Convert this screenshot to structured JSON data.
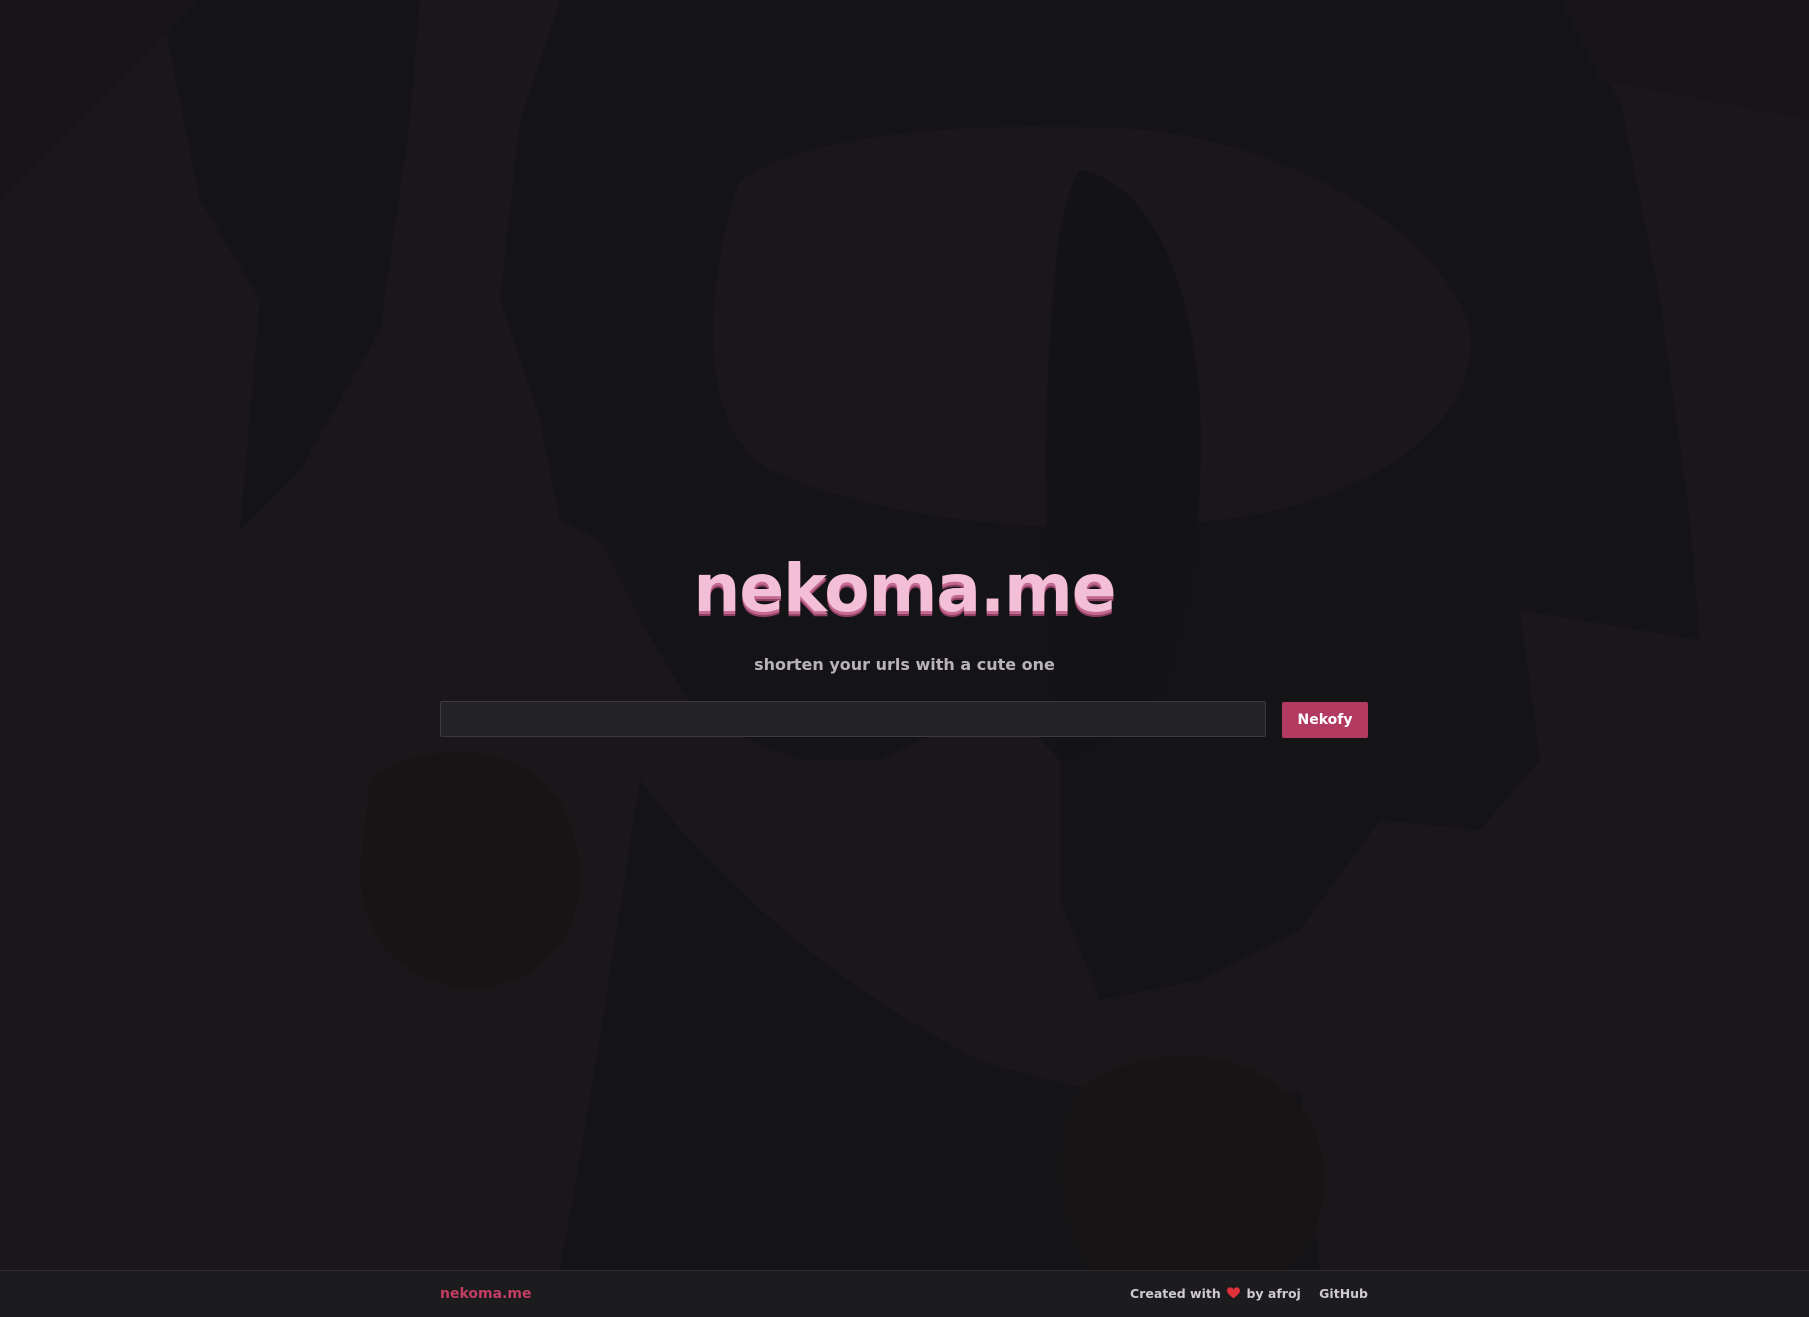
{
  "site": {
    "logo_text": "nekoma.me",
    "tagline": "shorten your urls with a cute one"
  },
  "form": {
    "url_input_value": "",
    "url_input_placeholder": "",
    "submit_label": "Nekofy"
  },
  "footer": {
    "brand": "nekoma.me",
    "created_with_prefix": "Created with",
    "heart_icon": "heart-icon",
    "author_text": "by afroj",
    "github_label": "GitHub"
  },
  "colors": {
    "page_background": "#1a1619",
    "logo_pink": "#f2bfd6",
    "accent": "#b23a60",
    "footer_brand": "#c43d63",
    "heart": "#e0303a"
  }
}
